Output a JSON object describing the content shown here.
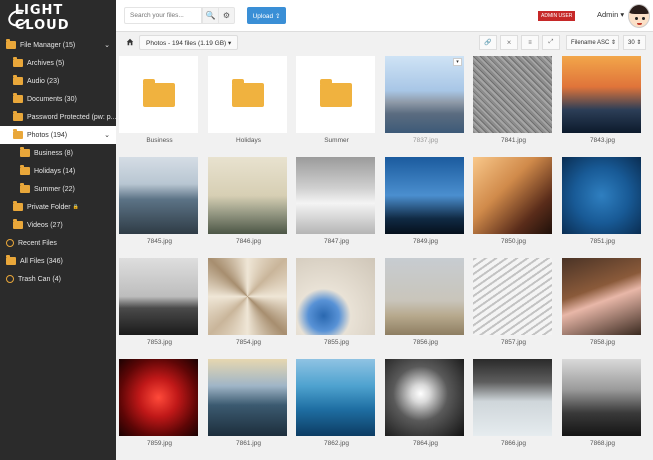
{
  "sidebar": {
    "logo": "LIGHT CLOUD",
    "items": [
      {
        "label": "File Manager (15)",
        "level": 0,
        "icon": "folder-icon",
        "caret": "⌄"
      },
      {
        "label": "Archives (5)",
        "level": 1,
        "icon": "folder-icon"
      },
      {
        "label": "Audio (23)",
        "level": 1,
        "icon": "folder-icon"
      },
      {
        "label": "Documents (30)",
        "level": 1,
        "icon": "folder-icon"
      },
      {
        "label": "Password Protected (pw: p...",
        "level": 1,
        "icon": "folder-icon"
      },
      {
        "label": "Photos (194)",
        "level": 1,
        "icon": "folder-icon",
        "active": true,
        "caret": "⌄"
      },
      {
        "label": "Business (8)",
        "level": 2,
        "icon": "folder-icon"
      },
      {
        "label": "Holidays (14)",
        "level": 2,
        "icon": "folder-icon"
      },
      {
        "label": "Summer (22)",
        "level": 2,
        "icon": "folder-icon"
      },
      {
        "label": "Private Folder",
        "level": 1,
        "icon": "folder-icon",
        "lock": "🔒"
      },
      {
        "label": "Videos (27)",
        "level": 1,
        "icon": "folder-icon"
      },
      {
        "label": "Recent Files",
        "level": 0,
        "icon": "clock-icon"
      },
      {
        "label": "All Files (346)",
        "level": 0,
        "icon": "folder-icon"
      },
      {
        "label": "Trash Can (4)",
        "level": 0,
        "icon": "trash-icon"
      }
    ]
  },
  "topbar": {
    "search_placeholder": "Search your files...",
    "search_icon": "🔍",
    "settings_icon": "⚙",
    "upload_label": "Upload ⇪",
    "admin_badge": "ADMIN USER",
    "user_label": "Admin ▾"
  },
  "toolbar": {
    "breadcrumb": "Photos - 194 files (1.19 GB)  ▾",
    "buttons": [
      "🔗",
      "⨯",
      "≡",
      "⤢"
    ],
    "sort_label": "Filename ASC ⇕",
    "per_page": "30 ⇕"
  },
  "colors": {
    "accent": "#3a8fd6",
    "folder": "#f0b23f",
    "badge": "#c62828",
    "sidebar": "#2b2b2b"
  },
  "files": [
    {
      "name": "Business",
      "type": "folder"
    },
    {
      "name": "Holidays",
      "type": "folder"
    },
    {
      "name": "Summer",
      "type": "folder"
    },
    {
      "name": "7837.jpg",
      "type": "image",
      "bg": "linear-gradient(180deg,#cfe3f5 0%,#a8c6e6 45%,#8f9aa8 60%,#5b6c80 75%,#3d5a78 100%)",
      "dim": true
    },
    {
      "name": "7841.jpg",
      "type": "image",
      "bg": "repeating-linear-gradient(45deg,#8c8c8c 0 2px,#a5a5a5 2px 4px,#6f6f6f 4px 5px)"
    },
    {
      "name": "7843.jpg",
      "type": "image",
      "bg": "linear-gradient(180deg,#f2a64a 0%,#e0743a 40%,#2c3e57 70%,#0c1a2c 100%)"
    },
    {
      "name": "7845.jpg",
      "type": "image",
      "bg": "linear-gradient(180deg,#d5dde5 0%,#b8c6d2 35%,#5c7386 55%,#2f3c46 100%)"
    },
    {
      "name": "7846.jpg",
      "type": "image",
      "bg": "linear-gradient(180deg,#e8e2cf 0%,#d7cfb4 50%,#9ea08a 70%,#4c5646 100%)"
    },
    {
      "name": "7847.jpg",
      "type": "image",
      "bg": "linear-gradient(180deg,#9b9b9b 0%,#cfcfcf 40%,#f4f4f4 60%,#b5b5b5 100%)"
    },
    {
      "name": "7849.jpg",
      "type": "image",
      "bg": "linear-gradient(180deg,#1b5b9e 0%,#4b8fcf 50%,#102a44 80%,#05101c 100%)"
    },
    {
      "name": "7850.jpg",
      "type": "image",
      "bg": "linear-gradient(135deg,#f9c88a 0%,#d08a4a 40%,#5a2c1a 75%,#1f100a 100%)"
    },
    {
      "name": "7851.jpg",
      "type": "image",
      "bg": "radial-gradient(circle at 50% 50%,#2f7fc0 0%,#185a96 50%,#0a2d52 100%)"
    },
    {
      "name": "7853.jpg",
      "type": "image",
      "bg": "linear-gradient(180deg,#dedede 0%,#bdbdbd 50%,#4a4a4a 65%,#1b1b1b 100%)"
    },
    {
      "name": "7854.jpg",
      "type": "image",
      "bg": "conic-gradient(from 45deg,#c9b59a,#efe6d6,#a78e6f,#efe6d6,#c9b59a,#efe6d6,#a78e6f,#efe6d6,#c9b59a)"
    },
    {
      "name": "7855.jpg",
      "type": "image",
      "bg": "radial-gradient(circle at 35% 75%,#2a68b0 0%,#5892d6 20%,#e9e2d6 35%,#cfc6b8 100%)"
    },
    {
      "name": "7856.jpg",
      "type": "image",
      "bg": "linear-gradient(180deg,#c7ccd1 0%,#c9c5bb 55%,#b7a98d 75%,#8e7e62 100%)"
    },
    {
      "name": "7857.jpg",
      "type": "image",
      "bg": "repeating-linear-gradient(-35deg,#f4f4f4 0 4px,#c3c3c3 4px 6px)"
    },
    {
      "name": "7858.jpg",
      "type": "image",
      "bg": "linear-gradient(160deg,#4a3326 0%,#8a5a3a 40%,#e8b7a8 55%,#3a2a20 100%)"
    },
    {
      "name": "7859.jpg",
      "type": "image",
      "bg": "radial-gradient(circle at 50% 50%,#ff4a3a 0%,#c01818 35%,#5e0606 70%,#1a0202 100%)"
    },
    {
      "name": "7861.jpg",
      "type": "image",
      "bg": "linear-gradient(180deg,#e6d7b0 0%,#9fb5c7 35%,#3b5a70 60%,#1d2e3c 100%)"
    },
    {
      "name": "7862.jpg",
      "type": "image",
      "bg": "linear-gradient(180deg,#8fc3e3 0%,#4ea2cf 35%,#1f6fa3 65%,#0c3c63 100%)"
    },
    {
      "name": "7864.jpg",
      "type": "image",
      "bg": "radial-gradient(circle at 45% 45%,#ffffff 0%,#d9d9d9 15%,#5a5a5a 45%,#121212 100%)"
    },
    {
      "name": "7866.jpg",
      "type": "image",
      "bg": "linear-gradient(180deg,#2a2a2a 0%,#5e5e5e 30%,#cfd6da 55%,#e6ecef 100%)"
    },
    {
      "name": "7868.jpg",
      "type": "image",
      "bg": "linear-gradient(180deg,#d9d9d9 0%,#9a9a9a 40%,#3a3a3a 70%,#151515 100%)"
    }
  ]
}
